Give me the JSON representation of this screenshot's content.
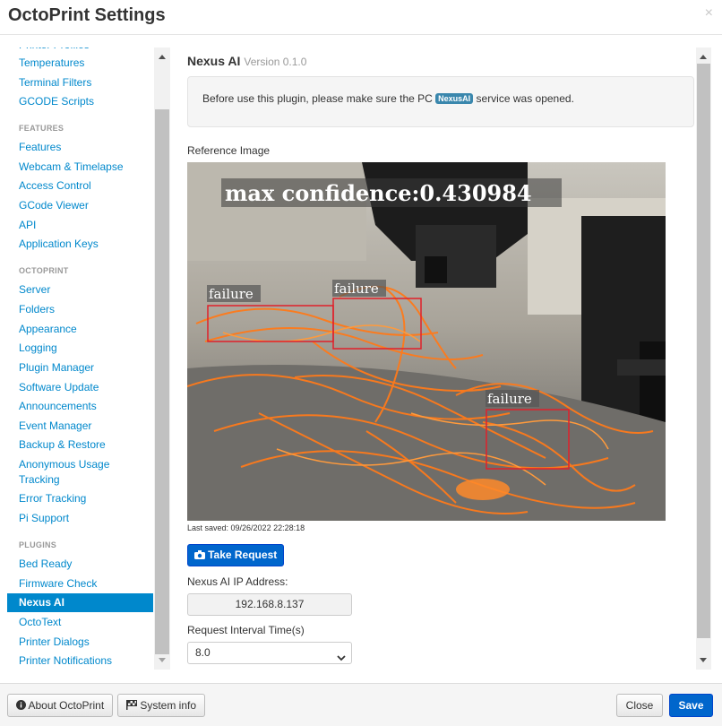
{
  "dialog": {
    "title": "OctoPrint Settings",
    "close_glyph": "×"
  },
  "sidebar": {
    "truncated_top": "Printer Profiles",
    "items_a": [
      "Temperatures",
      "Terminal Filters",
      "GCODE Scripts"
    ],
    "header_features": "FEATURES",
    "items_features": [
      "Features",
      "Webcam & Timelapse",
      "Access Control",
      "GCode Viewer",
      "API",
      "Application Keys"
    ],
    "header_octoprint": "OCTOPRINT",
    "items_octoprint": [
      "Server",
      "Folders",
      "Appearance",
      "Logging",
      "Plugin Manager",
      "Software Update",
      "Announcements",
      "Event Manager",
      "Backup & Restore",
      "Anonymous Usage Tracking",
      "Error Tracking",
      "Pi Support"
    ],
    "header_plugins": "PLUGINS",
    "items_plugins": [
      "Bed Ready",
      "Firmware Check",
      "Nexus AI",
      "OctoText",
      "Printer Dialogs",
      "Printer Notifications"
    ],
    "active": "Nexus AI"
  },
  "plugin": {
    "name": "Nexus AI",
    "version": "Version 0.1.0",
    "notice_before": "Before use this plugin, please make sure the PC",
    "notice_badge": "NexusAI",
    "notice_after": "service was opened.",
    "reference_label": "Reference Image",
    "overlay_confidence": "max confidence:0.430984",
    "detections": [
      "failure",
      "failure",
      "failure"
    ],
    "last_saved": "Last saved: 09/26/2022 22:28:18",
    "take_request": "Take Request",
    "ip_label": "Nexus AI IP Address:",
    "ip_value": "192.168.8.137",
    "interval_label": "Request Interval Time(s)",
    "interval_value": "8.0"
  },
  "footer": {
    "about": "About OctoPrint",
    "system_info": "System info",
    "close": "Close",
    "save": "Save"
  },
  "colors": {
    "accent": "#0088cc",
    "primary_button": "#0066cc",
    "badge": "#3a87ad",
    "detection_box": "#e0202a",
    "filament": "#ff7a1a"
  }
}
